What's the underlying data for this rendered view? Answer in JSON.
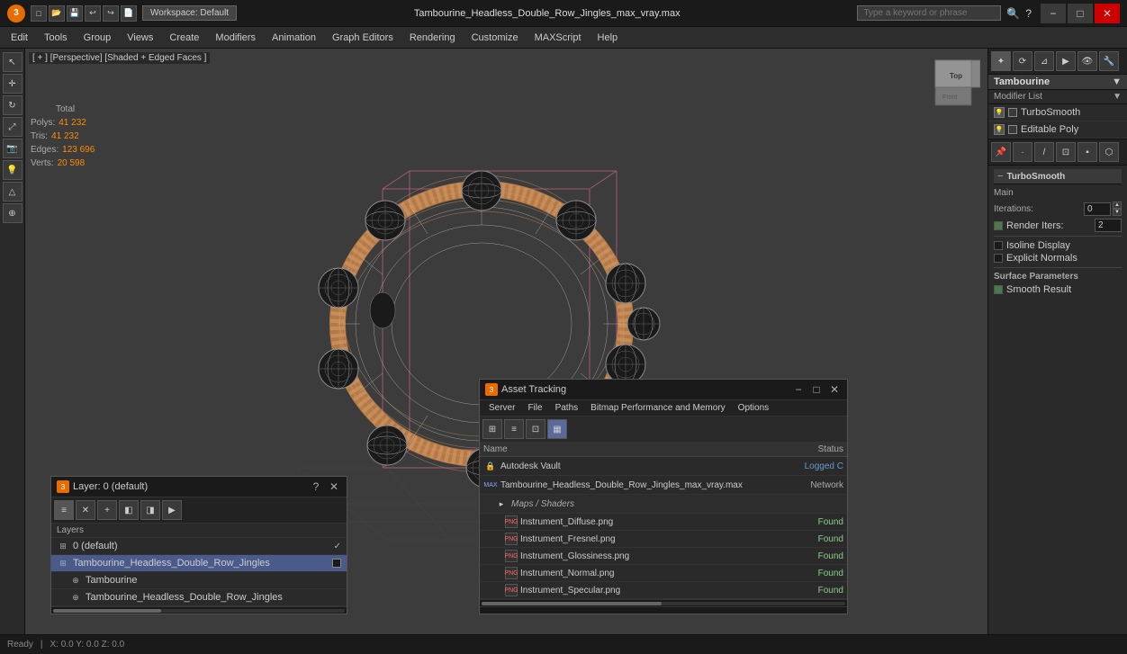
{
  "titlebar": {
    "file_title": "Tambourine_Headless_Double_Row_Jingles_max_vray.max",
    "workspace_label": "Workspace: Default",
    "search_placeholder": "Type a keyword or phrase",
    "minimize": "−",
    "maximize": "□",
    "close": "✕"
  },
  "menubar": {
    "items": [
      "Edit",
      "Tools",
      "Group",
      "Views",
      "Create",
      "Modifiers",
      "Animation",
      "Graph Editors",
      "Rendering",
      "Customize",
      "MAXScript",
      "Help"
    ]
  },
  "viewport": {
    "label": "[ + ] [Perspective] [Shaded + Edged Faces ]",
    "stats": {
      "polys_label": "Polys:",
      "polys_value": "41 232",
      "tris_label": "Tris:",
      "tris_value": "41 232",
      "edges_label": "Edges:",
      "edges_value": "123 696",
      "verts_label": "Verts:",
      "verts_value": "20 598",
      "total_label": "Total"
    }
  },
  "right_panel": {
    "object_name": "Tambourine",
    "modifier_list_label": "Modifier List",
    "modifiers": [
      {
        "name": "TurboSmooth",
        "active": false
      },
      {
        "name": "Editable Poly",
        "active": false
      }
    ],
    "turbosmooth": {
      "title": "TurboSmooth",
      "main_label": "Main",
      "iterations_label": "Iterations:",
      "iterations_value": "0",
      "render_iters_label": "Render Iters:",
      "render_iters_value": "2",
      "isoline_display_label": "Isoline Display",
      "explicit_normals_label": "Explicit Normals",
      "surface_params_label": "Surface Parameters",
      "smooth_result_label": "Smooth Result"
    }
  },
  "layers_panel": {
    "title": "Layer: 0 (default)",
    "toolbar_items": [
      "≡",
      "✕",
      "+",
      "◧",
      "◨",
      "▶"
    ],
    "label": "Layers",
    "items": [
      {
        "name": "0 (default)",
        "indent": 0,
        "checked": true,
        "selected": false,
        "icon": "⊞"
      },
      {
        "name": "Tambourine_Headless_Double_Row_Jingles",
        "indent": 0,
        "checked": false,
        "selected": true,
        "icon": "⊞",
        "has_box": true
      },
      {
        "name": "Tambourine",
        "indent": 1,
        "checked": false,
        "selected": false,
        "icon": "⊕"
      },
      {
        "name": "Tambourine_Headless_Double_Row_Jingles",
        "indent": 1,
        "checked": false,
        "selected": false,
        "icon": "⊕"
      }
    ]
  },
  "asset_panel": {
    "title": "Asset Tracking",
    "menu_items": [
      "Server",
      "File",
      "Paths",
      "Bitmap Performance and Memory",
      "Options"
    ],
    "toolbar_items": [
      "⊞",
      "≡",
      "⊡",
      "⊞",
      "▦"
    ],
    "col_name": "Name",
    "col_status": "Status",
    "rows": [
      {
        "icon": "🔒",
        "name": "Autodesk Vault",
        "status": "Logged C",
        "status_class": "status-logged",
        "indent": 0,
        "row_class": ""
      },
      {
        "icon": "🎵",
        "name": "Tambourine_Headless_Double_Row_Jingles_max_vray.max",
        "status": "Network",
        "status_class": "status-network",
        "indent": 0,
        "row_class": ""
      },
      {
        "icon": "📁",
        "name": "Maps / Shaders",
        "status": "",
        "status_class": "",
        "indent": 1,
        "row_class": "section-header"
      },
      {
        "icon": "🖼",
        "name": "Instrument_Diffuse.png",
        "status": "Found",
        "status_class": "status-found",
        "indent": 2,
        "row_class": ""
      },
      {
        "icon": "🖼",
        "name": "Instrument_Fresnel.png",
        "status": "Found",
        "status_class": "status-found",
        "indent": 2,
        "row_class": ""
      },
      {
        "icon": "🖼",
        "name": "Instrument_Glossiness.png",
        "status": "Found",
        "status_class": "status-found",
        "indent": 2,
        "row_class": ""
      },
      {
        "icon": "🖼",
        "name": "Instrument_Normal.png",
        "status": "Found",
        "status_class": "status-found",
        "indent": 2,
        "row_class": ""
      },
      {
        "icon": "🖼",
        "name": "Instrument_Specular.png",
        "status": "Found",
        "status_class": "status-found",
        "indent": 2,
        "row_class": ""
      }
    ]
  },
  "colors": {
    "accent": "#e86c00",
    "selected_blue": "#4a5a8a",
    "status_found": "#88cc88",
    "status_network": "#aaaaaa",
    "status_logged": "#6699cc"
  }
}
